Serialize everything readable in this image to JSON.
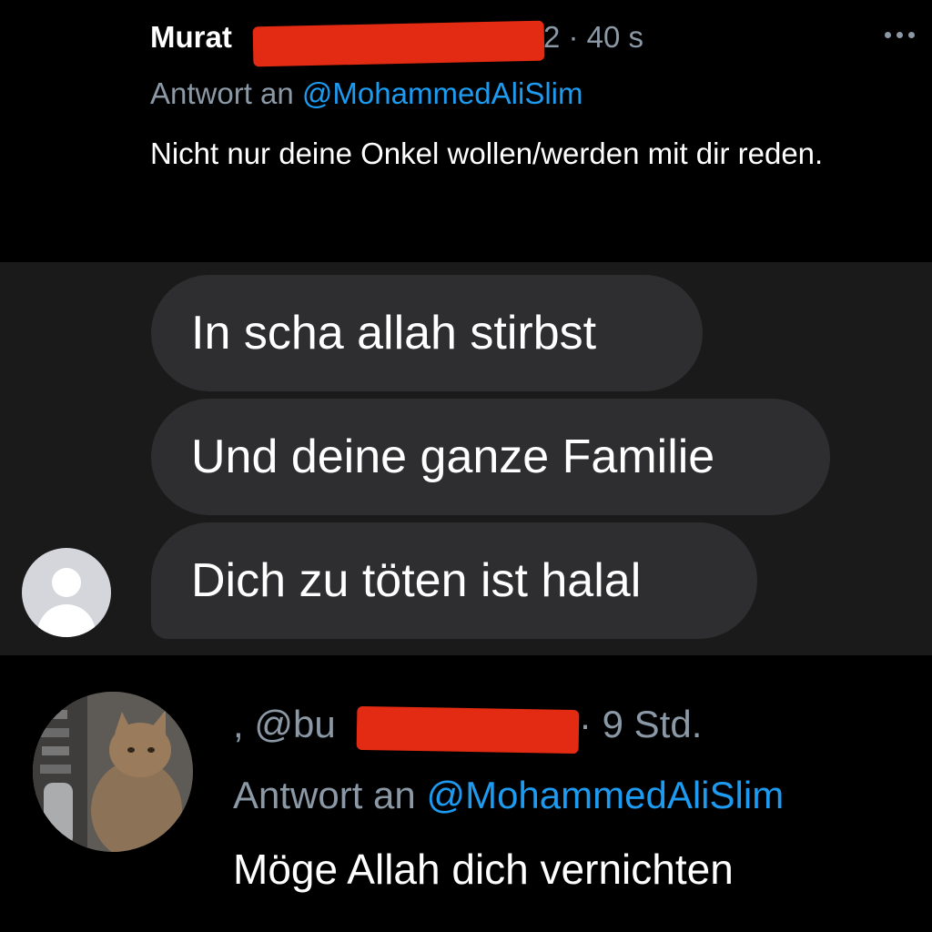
{
  "tweet1": {
    "display_name": "Murat",
    "time": "2 · 40 s",
    "reply_prefix": "Antwort an ",
    "reply_handle": "@MohammedAliSlim",
    "body": "Nicht nur deine Onkel wollen/werden mit dir reden."
  },
  "chat": {
    "messages": [
      "In scha allah stirbst",
      "Und deine ganze Familie",
      "Dich zu töten ist halal"
    ]
  },
  "tweet2": {
    "name_prefix": ", @bu",
    "time": "· 9 Std.",
    "reply_prefix": "Antwort an ",
    "reply_handle": "@MohammedAliSlim",
    "body": "Möge Allah dich vernichten"
  },
  "colors": {
    "link": "#1d9bf0",
    "redaction": "#e32a12",
    "bubble": "#2e2e30"
  }
}
